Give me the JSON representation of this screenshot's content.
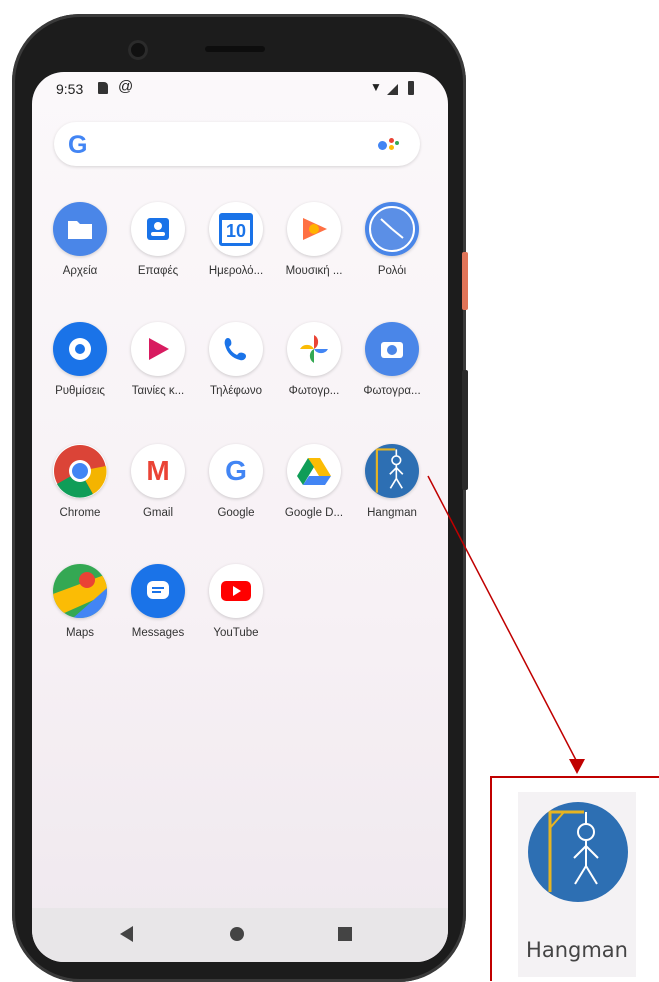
{
  "status": {
    "time": "9:53",
    "at_symbol": "@",
    "wifi_symbol": "▼"
  },
  "search": {
    "google_letter": "G"
  },
  "apps": [
    {
      "label": "Αρχεία",
      "icon": "files-icon",
      "bg": "#4a86e8"
    },
    {
      "label": "Επαφές",
      "icon": "contacts-icon",
      "bg": "#ffffff"
    },
    {
      "label": "Ημερολό...",
      "icon": "calendar-icon",
      "bg": "#ffffff",
      "glyph": "10"
    },
    {
      "label": "Μουσική ...",
      "icon": "music-icon",
      "bg": "#ffffff"
    },
    {
      "label": "Ρολόι",
      "icon": "clock-icon",
      "bg": "#4a86e8"
    },
    {
      "label": "Ρυθμίσεις",
      "icon": "settings-icon",
      "bg": "#1a73e8"
    },
    {
      "label": "Ταινίες κ...",
      "icon": "movies-icon",
      "bg": "#ffffff"
    },
    {
      "label": "Τηλέφωνο",
      "icon": "phone-icon",
      "bg": "#ffffff"
    },
    {
      "label": "Φωτογρ...",
      "icon": "photos-icon",
      "bg": "#ffffff"
    },
    {
      "label": "Φωτογρα...",
      "icon": "camera-icon",
      "bg": "#4a86e8"
    },
    {
      "label": "Chrome",
      "icon": "chrome-icon",
      "bg": "#ffffff"
    },
    {
      "label": "Gmail",
      "icon": "gmail-icon",
      "bg": "#ffffff",
      "glyph": "M"
    },
    {
      "label": "Google",
      "icon": "google-icon",
      "bg": "#ffffff",
      "glyph": "G"
    },
    {
      "label": "Google D...",
      "icon": "drive-icon",
      "bg": "#ffffff"
    },
    {
      "label": "Hangman",
      "icon": "hangman-icon",
      "bg": "#2d6fb3"
    },
    {
      "label": "Maps",
      "icon": "maps-icon",
      "bg": "#ffffff"
    },
    {
      "label": "Messages",
      "icon": "messages-icon",
      "bg": "#1a73e8"
    },
    {
      "label": "YouTube",
      "icon": "youtube-icon",
      "bg": "#ffffff"
    }
  ],
  "callout": {
    "label": "Hangman",
    "icon": "hangman-icon"
  },
  "colors": {
    "annotation": "#c00000",
    "hangman_bg": "#2d6fb3",
    "hangman_gallows": "#e6b422"
  }
}
